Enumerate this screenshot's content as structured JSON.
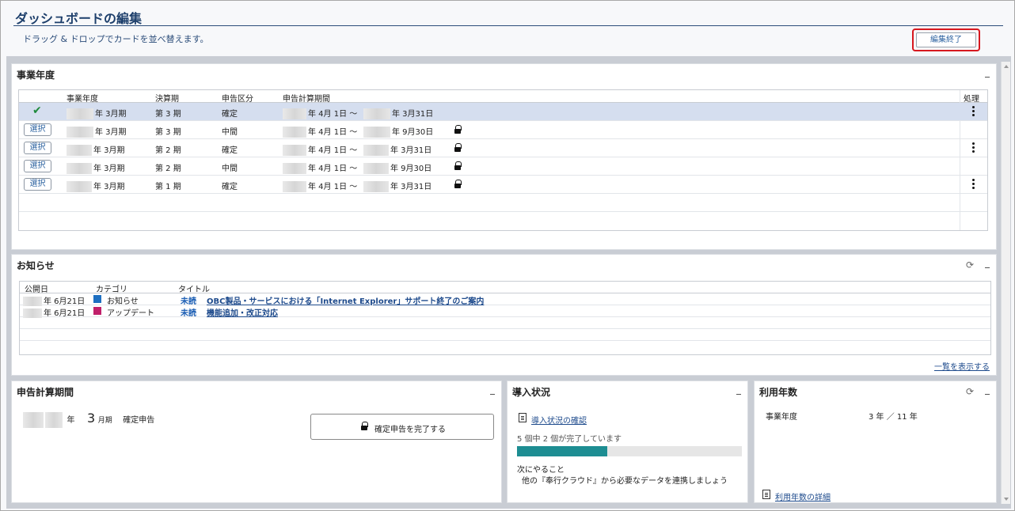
{
  "header": {
    "title": "ダッシュボードの編集",
    "subtitle": "ドラッグ & ドロップでカードを並べ替えます。",
    "finish_button": "編集終了"
  },
  "fiscal_card": {
    "title": "事業年度",
    "columns": {
      "year": "事業年度",
      "term": "決算期",
      "type": "申告区分",
      "period": "申告計算期間",
      "action": "処理"
    },
    "select_label": "選択",
    "rows": [
      {
        "selected": true,
        "year": "年 3月期",
        "term": "第 3 期",
        "type": "確定",
        "from": "年 4月 1日 ～",
        "to": "年 3月31日",
        "locked": false,
        "menu": true
      },
      {
        "selected": false,
        "year": "年 3月期",
        "term": "第 3 期",
        "type": "中間",
        "from": "年 4月 1日 ～",
        "to": "年 9月30日",
        "locked": true,
        "menu": false
      },
      {
        "selected": false,
        "year": "年 3月期",
        "term": "第 2 期",
        "type": "確定",
        "from": "年 4月 1日 ～",
        "to": "年 3月31日",
        "locked": true,
        "menu": true
      },
      {
        "selected": false,
        "year": "年 3月期",
        "term": "第 2 期",
        "type": "中間",
        "from": "年 4月 1日 ～",
        "to": "年 9月30日",
        "locked": true,
        "menu": false
      },
      {
        "selected": false,
        "year": "年 3月期",
        "term": "第 1 期",
        "type": "確定",
        "from": "年 4月 1日 ～",
        "to": "年 3月31日",
        "locked": true,
        "menu": true
      }
    ]
  },
  "news_card": {
    "title": "お知らせ",
    "columns": {
      "date": "公開日",
      "category": "カテゴリ",
      "title": "タイトル"
    },
    "rows": [
      {
        "date": "年 6月21日",
        "category": "お知らせ",
        "category_color": "#1d6fc1",
        "status": "未読",
        "title": "OBC製品・サービスにおける「Internet Explorer」サポート終了のご案内"
      },
      {
        "date": "年 6月21日",
        "category": "アップデート",
        "category_color": "#c0206a",
        "status": "未読",
        "title": "機能追加・改正対応"
      }
    ],
    "show_all": "一覧を表示する"
  },
  "period_card": {
    "title": "申告計算期間",
    "year_suffix": "年",
    "month_number": "3",
    "month_suffix": "月期",
    "type_label": "確定申告",
    "complete_button": "確定申告を完了する"
  },
  "intro_card": {
    "title": "導入状況",
    "check_link": "導入状況の確認",
    "progress_text": "5 個中 2 個が完了しています",
    "progress_fraction": 0.4,
    "next_label": "次にやること",
    "next_text": "他の『奉行クラウド』から必要なデータを連携しましょう"
  },
  "usage_card": {
    "title": "利用年数",
    "label": "事業年度",
    "value": "3 年 ／ 11 年",
    "detail_link": "利用年数の詳細"
  }
}
